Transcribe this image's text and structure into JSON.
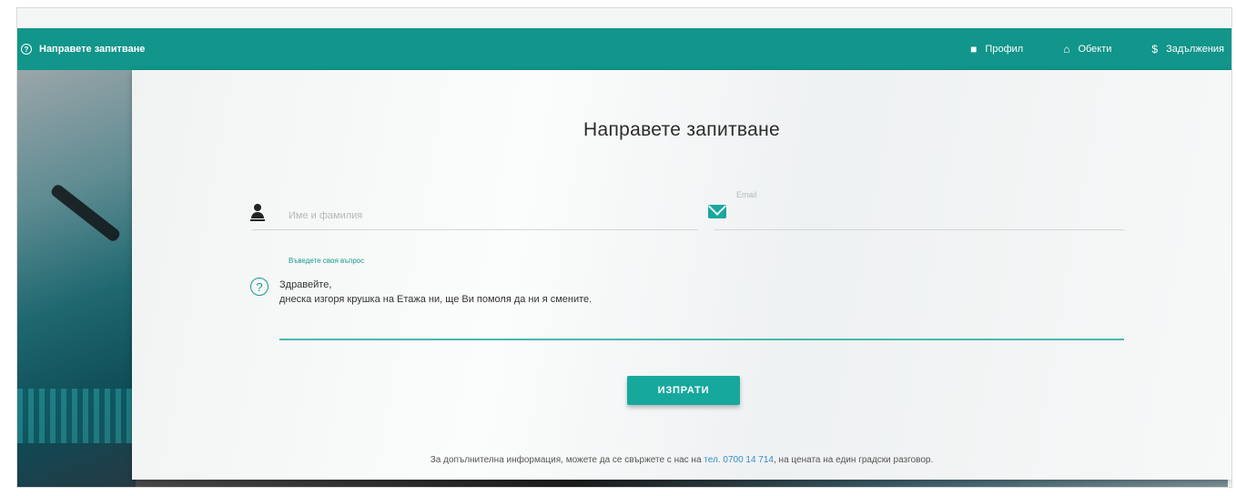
{
  "topbar": {
    "brand_label": "Направете запитване",
    "nav": [
      {
        "icon": "person-icon",
        "label": "Профил"
      },
      {
        "icon": "home-icon",
        "label": "Обекти"
      },
      {
        "icon": "dollar-icon",
        "label": "Задължения"
      }
    ]
  },
  "form": {
    "title": "Направете запитване",
    "name_placeholder": "Име и фамилия",
    "email_label": "Email",
    "email_value": "",
    "message_label": "Въведете своя въпрос",
    "message_text": "Здравейте,\nднеска изгоря крушка на Етажа ни, ще Ви помоля да ни я смените.",
    "submit_label": "ИЗПРАТИ"
  },
  "footer": {
    "text_before": "За допълнителна информация, можете да се свържете с нас на ",
    "phone": "тел. 0700 14 714",
    "text_after": ", на цената на един градски разговор."
  },
  "colors": {
    "primary": "#12958a",
    "button": "#17a89d",
    "link": "#3a8ccc"
  }
}
